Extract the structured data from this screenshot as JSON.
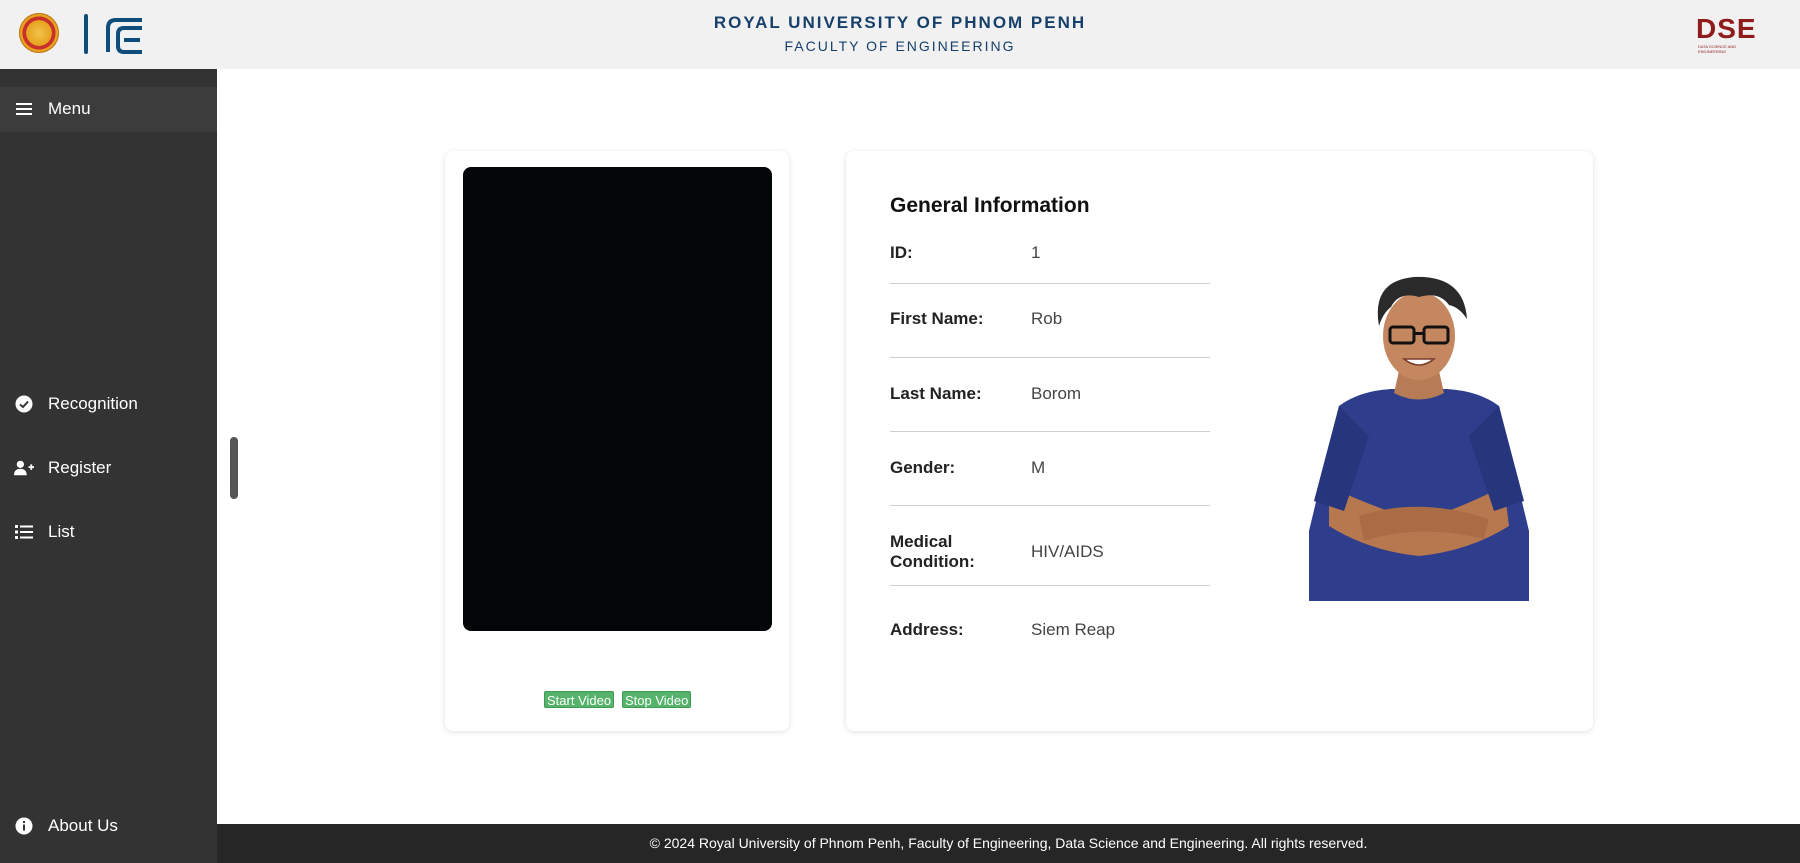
{
  "header": {
    "title": "ROYAL UNIVERSITY OF PHNOM PENH",
    "subtitle": "FACULTY OF ENGINEERING",
    "right_logo_text": "DSE",
    "right_logo_small": "DATA SCIENCE AND ENGINEERING"
  },
  "sidebar": {
    "menu_label": "Menu",
    "items": [
      {
        "label": "Recognition",
        "icon": "check-circle-icon"
      },
      {
        "label": "Register",
        "icon": "user-plus-icon"
      },
      {
        "label": "List",
        "icon": "list-icon"
      }
    ],
    "about_label": "About Us"
  },
  "video": {
    "start_label": "Start Video",
    "stop_label": "Stop Video"
  },
  "info": {
    "title": "General Information",
    "fields": [
      {
        "label": "ID:",
        "value": "1"
      },
      {
        "label": "First Name:",
        "value": "Rob"
      },
      {
        "label": "Last Name:",
        "value": "Borom"
      },
      {
        "label": "Gender:",
        "value": "M"
      },
      {
        "label": "Medical Condition:",
        "value": "HIV/AIDS"
      },
      {
        "label": "Address:",
        "value": "Siem Reap"
      }
    ]
  },
  "footer": {
    "text": "© 2024 Royal University of Phnom Penh, Faculty of Engineering, Data Science and Engineering. All rights reserved."
  },
  "colors": {
    "header_bg": "#f1f1f1",
    "header_text": "#17406a",
    "sidebar_bg": "#333333",
    "footer_bg": "#262626",
    "button_green": "#55b36b",
    "dse_red": "#8f1b1b"
  }
}
